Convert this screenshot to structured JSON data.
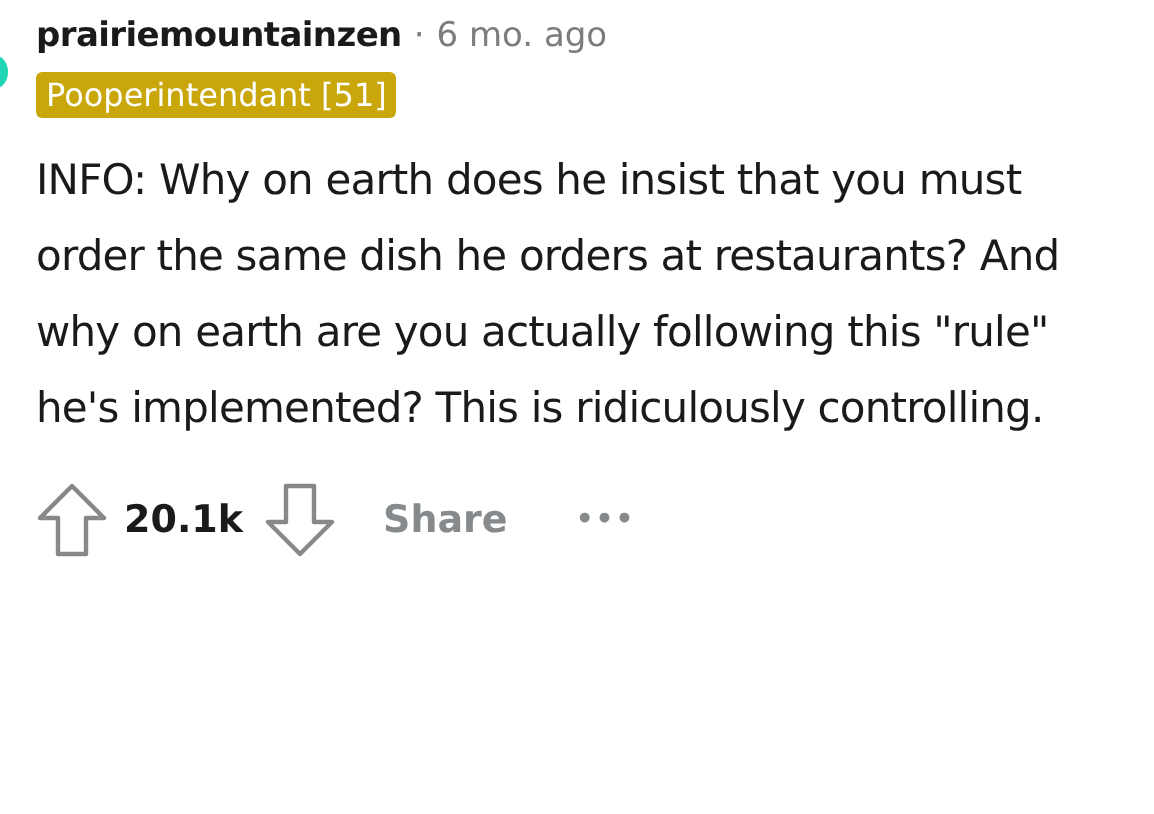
{
  "comment": {
    "author": "prairiemountainzen",
    "separator": "·",
    "age": "6 mo. ago",
    "flair": "Pooperintendant [51]",
    "body": "INFO: Why on earth does he insist that you must order the same dish he orders at restaurants? And why on earth are you actually following this \"rule\" he's implemented? This is ridiculously controlling.",
    "score": "20.1k",
    "share": "Share",
    "more": "•••"
  }
}
